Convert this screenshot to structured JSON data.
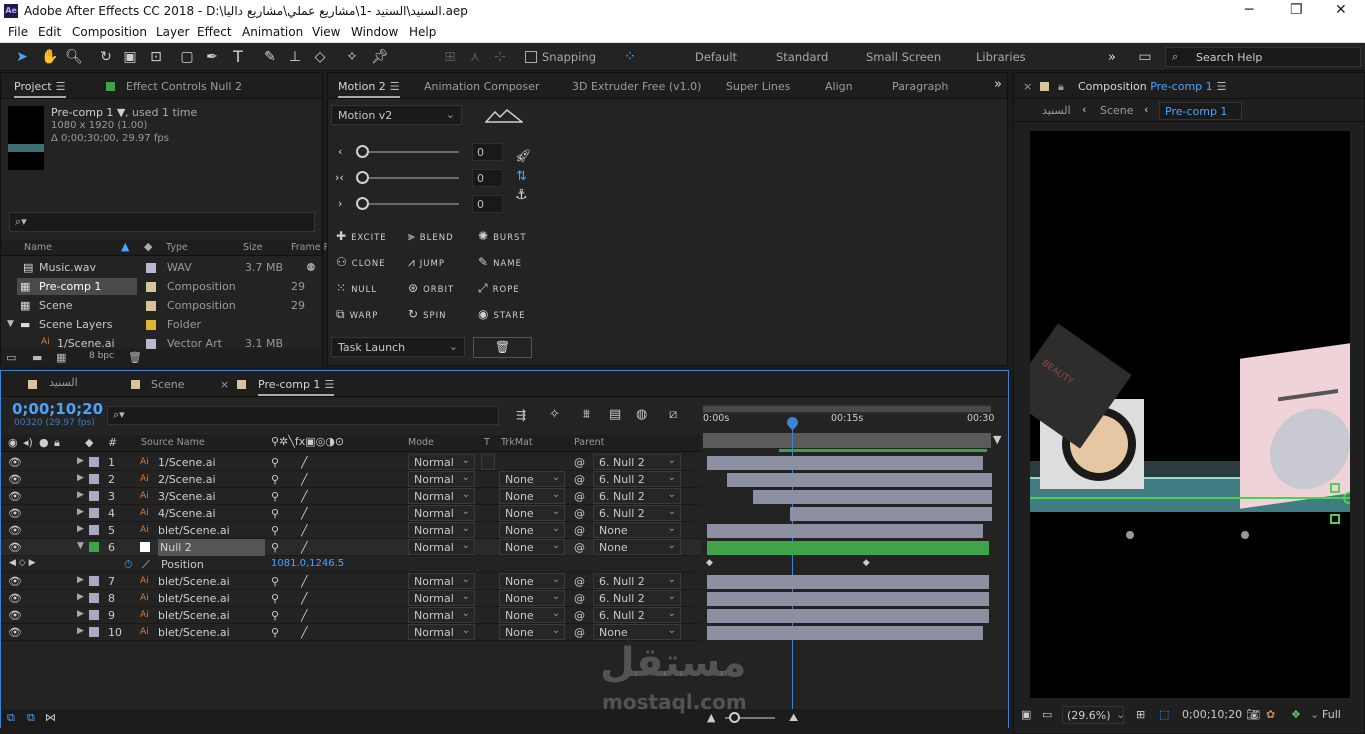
{
  "app": {
    "title": "Adobe After Effects CC 2018 - D:\\السنيد\\السنيد -1\\مشاريع عملي\\مشاريع داليا.aep",
    "icon_text": "Ae"
  },
  "menu": [
    "File",
    "Edit",
    "Composition",
    "Layer",
    "Effect",
    "Animation",
    "View",
    "Window",
    "Help"
  ],
  "toolbar": {
    "snapping": "Snapping",
    "workspaces": [
      "Default",
      "Standard",
      "Small Screen",
      "Libraries"
    ],
    "search_help": "Search Help"
  },
  "project_panel": {
    "tab_project": "Project",
    "tab_effects": "Effect Controls Null 2",
    "comp_name": "Pre-comp 1 ▼",
    "used": ", used 1 time",
    "dims": "1080 x 1920 (1.00)",
    "duration": "Δ 0;00;30;00, 29.97 fps",
    "search_placeholder": "",
    "columns": [
      "Name",
      "Type",
      "Size",
      "Frame R"
    ],
    "items": [
      {
        "name": "Music.wav",
        "type": "WAV",
        "size": "3.7 MB",
        "frame": ""
      },
      {
        "name": "Pre-comp 1",
        "type": "Composition",
        "size": "",
        "frame": "29"
      },
      {
        "name": "Scene",
        "type": "Composition",
        "size": "",
        "frame": "29"
      },
      {
        "name": "Scene Layers",
        "type": "Folder",
        "size": "",
        "frame": ""
      },
      {
        "name": "1/Scene.ai",
        "type": "Vector Art",
        "size": "3.1 MB",
        "frame": ""
      }
    ],
    "bpc": "8 bpc"
  },
  "motion_panel": {
    "tabs": [
      "Motion 2",
      "Animation Composer",
      "3D Extruder Free (v1.0)",
      "Super Lines",
      "Align",
      "Paragraph"
    ],
    "version": "Motion v2",
    "slider_values": [
      "0",
      "0",
      "0"
    ],
    "buttons": [
      "EXCITE",
      "BLEND",
      "BURST",
      "CLONE",
      "JUMP",
      "NAME",
      "NULL",
      "ORBIT",
      "ROPE",
      "WARP",
      "SPIN",
      "STARE"
    ],
    "task": "Task Launch"
  },
  "composition_panel": {
    "tab": "Composition",
    "comp": "Pre-comp 1",
    "breadcrumbs": [
      "السنيد",
      "Scene",
      "Pre-comp 1"
    ],
    "zoom": "(29.6%)",
    "timecode": "0;00;10;20",
    "quality": "Full",
    "product_text": "BEAUTY"
  },
  "timeline": {
    "tabs": [
      "السنيد",
      "Scene",
      "Pre-comp 1"
    ],
    "timecode": "0;00;10;20",
    "frames": "00320 (29.97 fps)",
    "headers": {
      "source": "Source Name",
      "mode": "Mode",
      "t": "T",
      "trkmat": "TrkMat",
      "parent": "Parent"
    },
    "ruler": [
      "0:00s",
      "00:15s",
      "00:30"
    ],
    "playhead_fraction": 0.355,
    "layers": [
      {
        "num": "1",
        "name": "1/Scene.ai",
        "mode": "Normal",
        "trkmat": "",
        "parent": "6. Null 2",
        "color": "#a9a9c4",
        "bar_start": 0.0,
        "bar_end": 0.97
      },
      {
        "num": "2",
        "name": "2/Scene.ai",
        "mode": "Normal",
        "trkmat": "None",
        "parent": "6. Null 2",
        "color": "#a9a9c4",
        "bar_start": 0.07,
        "bar_end": 1.0
      },
      {
        "num": "3",
        "name": "3/Scene.ai",
        "mode": "Normal",
        "trkmat": "None",
        "parent": "6. Null 2",
        "color": "#a9a9c4",
        "bar_start": 0.16,
        "bar_end": 1.0
      },
      {
        "num": "4",
        "name": "4/Scene.ai",
        "mode": "Normal",
        "trkmat": "None",
        "parent": "6. Null 2",
        "color": "#a9a9c4",
        "bar_start": 0.29,
        "bar_end": 1.0
      },
      {
        "num": "5",
        "name": "blet/Scene.ai",
        "mode": "Normal",
        "trkmat": "None",
        "parent": "None",
        "color": "#a9a9c4",
        "bar_start": 0.0,
        "bar_end": 0.97
      },
      {
        "num": "6",
        "name": "Null 2",
        "mode": "Normal",
        "trkmat": "None",
        "parent": "None",
        "color": "#3fa34a",
        "bar_start": 0.0,
        "bar_end": 0.99
      },
      {
        "num": "7",
        "name": "blet/Scene.ai",
        "mode": "Normal",
        "trkmat": "None",
        "parent": "6. Null 2",
        "color": "#a9a9c4",
        "bar_start": 0.0,
        "bar_end": 0.99
      },
      {
        "num": "8",
        "name": "blet/Scene.ai",
        "mode": "Normal",
        "trkmat": "None",
        "parent": "6. Null 2",
        "color": "#a9a9c4",
        "bar_start": 0.0,
        "bar_end": 0.99
      },
      {
        "num": "9",
        "name": "blet/Scene.ai",
        "mode": "Normal",
        "trkmat": "None",
        "parent": "6. Null 2",
        "color": "#a9a9c4",
        "bar_start": 0.0,
        "bar_end": 0.99
      },
      {
        "num": "10",
        "name": "blet/Scene.ai",
        "mode": "Normal",
        "trkmat": "None",
        "parent": "None",
        "color": "#a9a9c4",
        "bar_start": 0.0,
        "bar_end": 0.97
      }
    ],
    "position_label": "Position",
    "position_value": "1081.0,1246.5"
  },
  "watermark": {
    "arabic": "مستقل",
    "latin": "mostaql.com"
  }
}
